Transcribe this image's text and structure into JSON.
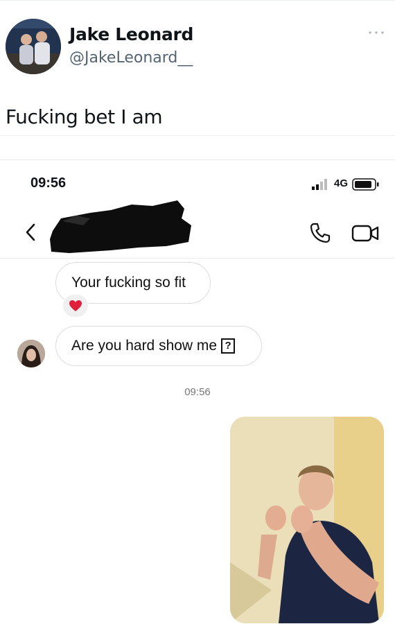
{
  "tweet": {
    "name": "Jake Leonard",
    "handle": "@JakeLeonard__",
    "text": "Fucking bet I am",
    "more_icon": "more-horizontal-icon"
  },
  "phone": {
    "status_time": "09:56",
    "network": "4G"
  },
  "chat": {
    "messages": [
      {
        "text": "Your fucking so fit",
        "reaction": "heart"
      },
      {
        "text": "Are you hard show me",
        "emoji_placeholder": "?"
      }
    ],
    "timestamp": "09:56"
  },
  "colors": {
    "handle_gray": "#536471",
    "bubble_border": "#dcdcdc",
    "heart": "#e0203a"
  }
}
